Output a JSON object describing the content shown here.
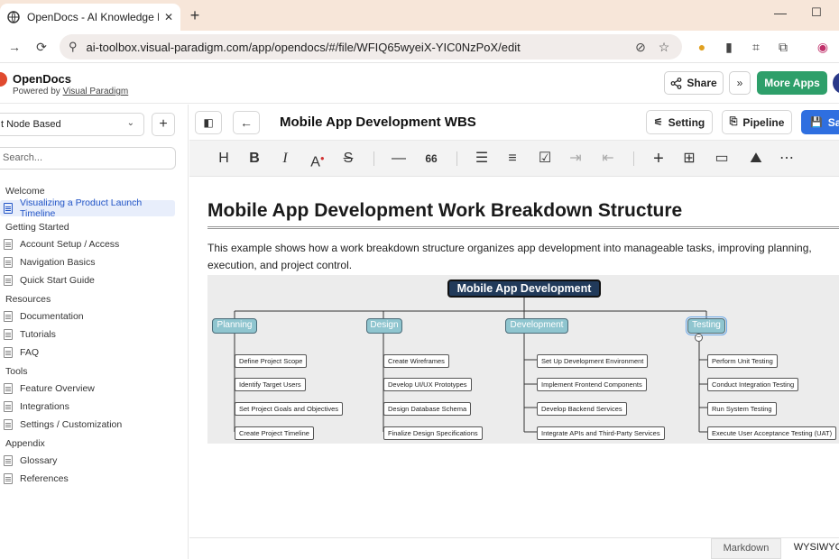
{
  "browser": {
    "tab_title": "OpenDocs - AI Knowledge Base",
    "tab_close": "✕",
    "new_tab": "+",
    "url": "ai-toolbox.visual-paradigm.com/app/opendocs/#/file/WFIQ65wyeiX-YIC0NzPoX/edit",
    "controls": {
      "minimize": "—",
      "maximize": "☐"
    }
  },
  "app": {
    "name": "OpenDocs",
    "powered_by_prefix": "Powered by ",
    "powered_by_link": "Visual Paradigm",
    "share_label": "Share",
    "more_apps_label": "More Apps",
    "accent_green": "#2e9f6a",
    "accent_blue": "#2f6fe0"
  },
  "sidebar": {
    "template_select": "t Node Based",
    "add_label": "+",
    "search_placeholder": "Search...",
    "sections": [
      {
        "label": "Welcome",
        "items": [
          "Visualizing a Product Launch Timeline"
        ]
      },
      {
        "label": "Getting Started",
        "items": [
          "Account Setup / Access",
          "Navigation Basics",
          "Quick Start Guide"
        ]
      },
      {
        "label": "Resources",
        "items": [
          "Documentation",
          "Tutorials",
          "FAQ"
        ]
      },
      {
        "label": "Tools",
        "items": [
          "Feature Overview",
          "Integrations",
          "Settings / Customization"
        ]
      },
      {
        "label": "Appendix",
        "items": [
          "Glossary",
          "References"
        ]
      }
    ],
    "active_item": "Visualizing a Product Launch Timeline"
  },
  "editor": {
    "doc_title": "Mobile App Development WBS",
    "setting_label": "Setting",
    "pipeline_label": "Pipeline",
    "save_label": "Save",
    "toolbar": {
      "heading": "H",
      "bold": "B",
      "italic": "I",
      "font": "A",
      "strike": "S",
      "rule": "—",
      "quote": "66",
      "more": "⋯"
    }
  },
  "content": {
    "heading": "Mobile App Development Work Breakdown Structure",
    "paragraph": "This example shows how a work breakdown structure organizes app development into manageable tasks, improving planning, execution, and project control."
  },
  "diagram": {
    "root": "Mobile App Development",
    "branches": [
      {
        "label": "Planning",
        "tasks": [
          "Define Project Scope",
          "Identify Target Users",
          "Set Project Goals and Objectives",
          "Create Project Timeline"
        ]
      },
      {
        "label": "Design",
        "tasks": [
          "Create Wireframes",
          "Develop UI/UX Prototypes",
          "Design Database Schema",
          "Finalize Design Specifications"
        ]
      },
      {
        "label": "Development",
        "tasks": [
          "Set Up Development Environment",
          "Implement Frontend Components",
          "Develop Backend Services",
          "Integrate APIs and Third-Party Services"
        ]
      },
      {
        "label": "Testing",
        "tasks": [
          "Perform Unit Testing",
          "Conduct Integration Testing",
          "Run System Testing",
          "Execute User Acceptance Testing (UAT)"
        ]
      }
    ],
    "collapse_symbol": "−"
  },
  "bottom": {
    "markdown_tab": "Markdown",
    "wysiwyg_tab": "WYSIWYG"
  }
}
